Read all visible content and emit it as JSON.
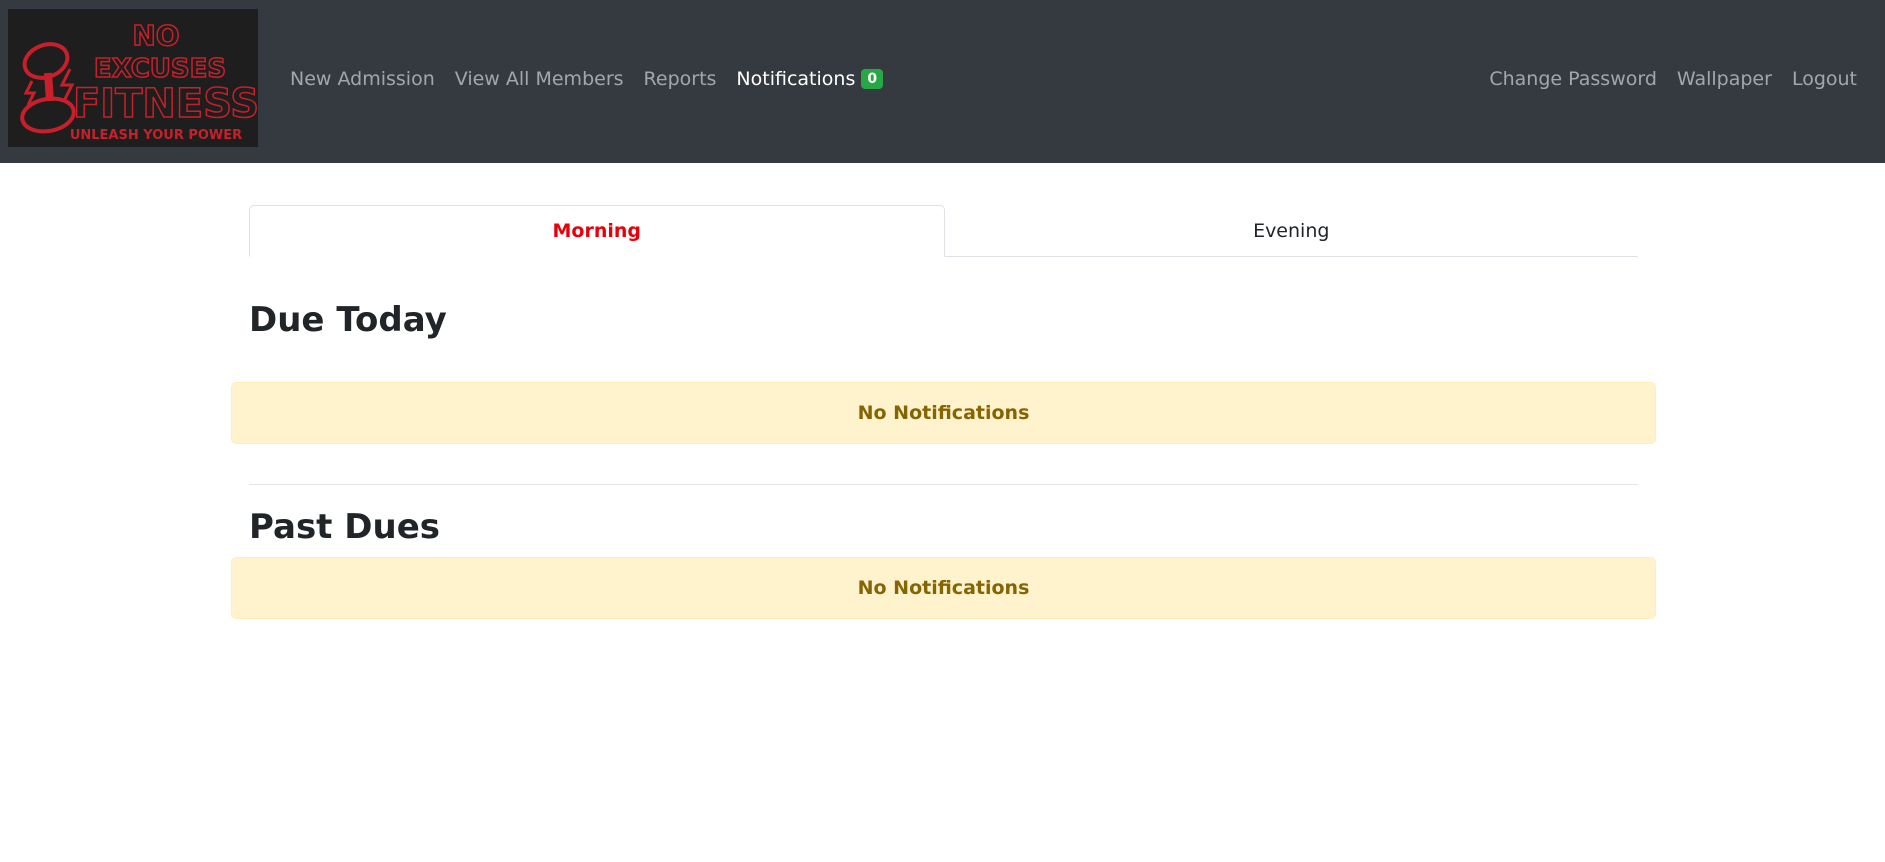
{
  "brand": {
    "logo_lines": [
      "NO",
      "EXCUSES",
      "FITNESS"
    ],
    "tagline": "UNLEASH YOUR POWER",
    "logo_color": "#c8202a"
  },
  "nav": {
    "left": [
      {
        "label": "New Admission"
      },
      {
        "label": "View All Members"
      },
      {
        "label": "Reports"
      },
      {
        "label": "Notifications",
        "badge": "0"
      }
    ],
    "right": [
      {
        "label": "Change Password"
      },
      {
        "label": "Wallpaper"
      },
      {
        "label": "Logout"
      }
    ]
  },
  "tabs": [
    {
      "label": "Morning",
      "active": true
    },
    {
      "label": "Evening",
      "active": false
    }
  ],
  "sections": {
    "due_today": {
      "title": "Due Today",
      "message": "No Notifications"
    },
    "past_dues": {
      "title": "Past Dues",
      "message": "No Notifications"
    }
  },
  "colors": {
    "navbar_bg": "#343a40",
    "badge_bg": "#28a745",
    "active_tab": "#e8000b",
    "alert_bg": "#fff3cd",
    "alert_text": "#856404"
  }
}
